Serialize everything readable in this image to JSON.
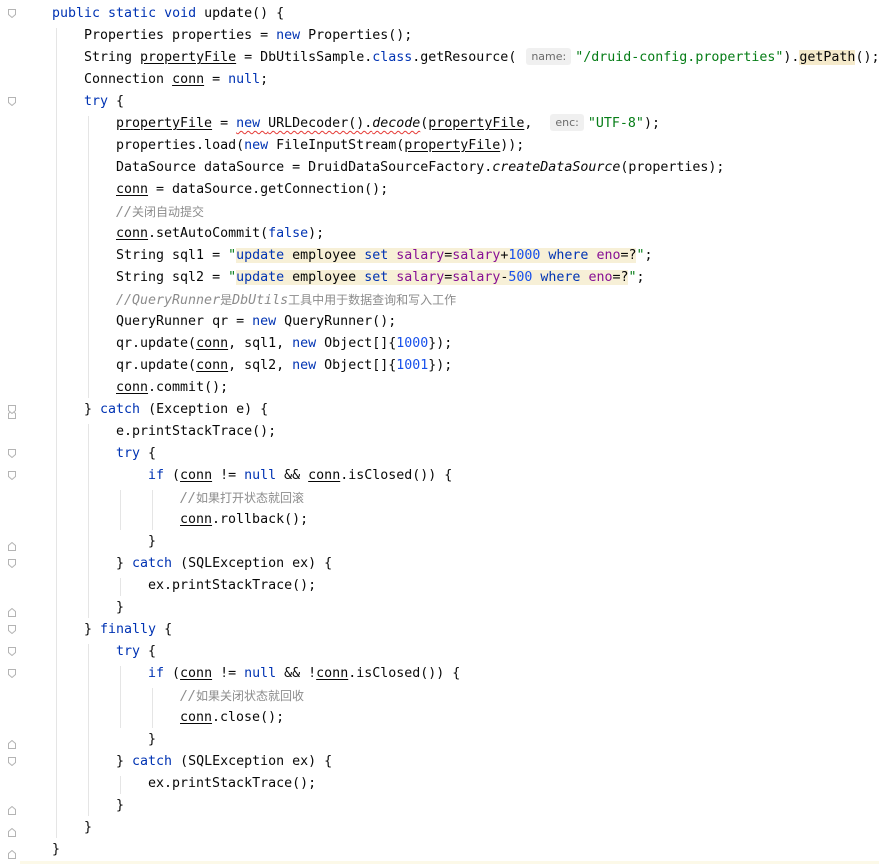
{
  "editor": {
    "lines": [
      {
        "indent": 0,
        "segs": [
          [
            "kw",
            "public static void "
          ],
          [
            "",
            "update() {"
          ]
        ]
      },
      {
        "indent": 1,
        "segs": [
          [
            "",
            "Properties properties = "
          ],
          [
            "kw",
            "new "
          ],
          [
            "",
            "Properties();"
          ]
        ]
      },
      {
        "indent": 1,
        "segs": [
          [
            "",
            "String "
          ],
          [
            "ul",
            "propertyFile"
          ],
          [
            "",
            " = DbUtilsSample."
          ],
          [
            "kw",
            "class"
          ],
          [
            "",
            ".getResource( "
          ],
          [
            "hint",
            "name:"
          ],
          [
            "str",
            "\"/druid-config.properties\""
          ],
          [
            "",
            ")."
          ],
          [
            "hl-y",
            "getPath"
          ],
          [
            "",
            "();"
          ]
        ]
      },
      {
        "indent": 1,
        "segs": [
          [
            "",
            "Connection "
          ],
          [
            "ul",
            "conn"
          ],
          [
            "",
            " = "
          ],
          [
            "kw",
            "null"
          ],
          [
            "",
            ";"
          ]
        ]
      },
      {
        "indent": 1,
        "segs": [
          [
            "kw",
            "try "
          ],
          [
            "",
            "{"
          ]
        ]
      },
      {
        "indent": 2,
        "segs": [
          [
            "ul",
            "propertyFile"
          ],
          [
            "",
            " = "
          ],
          [
            "squig-kw",
            "new "
          ],
          [
            "squig",
            "URLDecoder()."
          ],
          [
            "squig-it",
            "decode"
          ],
          [
            "",
            "("
          ],
          [
            "ul",
            "propertyFile"
          ],
          [
            "",
            ",  "
          ],
          [
            "hint",
            "enc:"
          ],
          [
            "str",
            "\"UTF-8\""
          ],
          [
            "",
            ");"
          ]
        ]
      },
      {
        "indent": 2,
        "segs": [
          [
            "",
            "properties.load("
          ],
          [
            "kw",
            "new "
          ],
          [
            "",
            "FileInputStream("
          ],
          [
            "ul",
            "propertyFile"
          ],
          [
            "",
            "));"
          ]
        ]
      },
      {
        "indent": 2,
        "segs": [
          [
            "",
            "DataSource dataSource = DruidDataSourceFactory."
          ],
          [
            "it",
            "createDataSource"
          ],
          [
            "",
            "(properties);"
          ]
        ]
      },
      {
        "indent": 2,
        "segs": [
          [
            "ul",
            "conn"
          ],
          [
            "",
            " = dataSource.getConnection();"
          ]
        ]
      },
      {
        "indent": 2,
        "segs": [
          [
            "cmt",
            "//"
          ],
          [
            "cmt-cn",
            "关闭自动提交"
          ]
        ]
      },
      {
        "indent": 2,
        "segs": [
          [
            "ul",
            "conn"
          ],
          [
            "",
            ".setAutoCommit("
          ],
          [
            "kw",
            "false"
          ],
          [
            "",
            ");"
          ]
        ]
      },
      {
        "indent": 2,
        "segs": [
          [
            "",
            "String sql1 = "
          ],
          [
            "str",
            "\""
          ],
          [
            "sql-kw",
            "update "
          ],
          [
            "sql",
            "employee "
          ],
          [
            "sql-kw",
            "set "
          ],
          [
            "sql-var",
            "salary"
          ],
          [
            "sql",
            "="
          ],
          [
            "sql-var",
            "salary"
          ],
          [
            "sql",
            "+"
          ],
          [
            "sql-num",
            "1000 "
          ],
          [
            "sql-kw",
            "where "
          ],
          [
            "sql-var",
            "eno"
          ],
          [
            "sql",
            "=?"
          ],
          [
            "str",
            "\""
          ],
          [
            "",
            ";"
          ]
        ]
      },
      {
        "indent": 2,
        "segs": [
          [
            "",
            "String sql2 = "
          ],
          [
            "str",
            "\""
          ],
          [
            "sql-kw",
            "update "
          ],
          [
            "sql",
            "employee "
          ],
          [
            "sql-kw",
            "set "
          ],
          [
            "sql-var",
            "salary"
          ],
          [
            "sql",
            "="
          ],
          [
            "sql-var",
            "salary"
          ],
          [
            "sql",
            "-"
          ],
          [
            "sql-num",
            "500 "
          ],
          [
            "sql-kw",
            "where "
          ],
          [
            "sql-var",
            "eno"
          ],
          [
            "sql",
            "=?"
          ],
          [
            "str",
            "\""
          ],
          [
            "",
            ";"
          ]
        ]
      },
      {
        "indent": 2,
        "segs": [
          [
            "cmt",
            "//QueryRunner"
          ],
          [
            "cmt-cn",
            "是"
          ],
          [
            "cmt",
            "DbUtils"
          ],
          [
            "cmt-cn",
            "工具中用于数据查询和写入工作"
          ]
        ]
      },
      {
        "indent": 2,
        "segs": [
          [
            "",
            "QueryRunner qr = "
          ],
          [
            "kw",
            "new "
          ],
          [
            "",
            "QueryRunner();"
          ]
        ]
      },
      {
        "indent": 2,
        "segs": [
          [
            "",
            "qr.update("
          ],
          [
            "ul",
            "conn"
          ],
          [
            "",
            ", sql1, "
          ],
          [
            "kw",
            "new "
          ],
          [
            "",
            "Object[]{"
          ],
          [
            "num",
            "1000"
          ],
          [
            "",
            "});"
          ]
        ]
      },
      {
        "indent": 2,
        "segs": [
          [
            "",
            "qr.update("
          ],
          [
            "ul",
            "conn"
          ],
          [
            "",
            ", sql2, "
          ],
          [
            "kw",
            "new "
          ],
          [
            "",
            "Object[]{"
          ],
          [
            "num",
            "1001"
          ],
          [
            "",
            "});"
          ]
        ]
      },
      {
        "indent": 2,
        "segs": [
          [
            "ul",
            "conn"
          ],
          [
            "",
            ".commit();"
          ]
        ]
      },
      {
        "indent": 1,
        "segs": [
          [
            "",
            "} "
          ],
          [
            "kw",
            "catch "
          ],
          [
            "",
            "(Exception e) {"
          ]
        ]
      },
      {
        "indent": 2,
        "segs": [
          [
            "",
            "e.printStackTrace();"
          ]
        ]
      },
      {
        "indent": 2,
        "segs": [
          [
            "kw",
            "try "
          ],
          [
            "",
            "{"
          ]
        ]
      },
      {
        "indent": 3,
        "segs": [
          [
            "kw",
            "if "
          ],
          [
            "",
            "("
          ],
          [
            "ul",
            "conn"
          ],
          [
            "",
            " != "
          ],
          [
            "kw",
            "null "
          ],
          [
            "",
            "&& "
          ],
          [
            "ul",
            "conn"
          ],
          [
            "",
            ".isClosed()) {"
          ]
        ]
      },
      {
        "indent": 4,
        "segs": [
          [
            "cmt",
            "//"
          ],
          [
            "cmt-cn",
            "如果打开状态就回滚"
          ]
        ]
      },
      {
        "indent": 4,
        "segs": [
          [
            "ul",
            "conn"
          ],
          [
            "",
            ".rollback();"
          ]
        ]
      },
      {
        "indent": 3,
        "segs": [
          [
            "",
            "}"
          ]
        ]
      },
      {
        "indent": 2,
        "segs": [
          [
            "",
            "} "
          ],
          [
            "kw",
            "catch "
          ],
          [
            "",
            "(SQLException ex) {"
          ]
        ]
      },
      {
        "indent": 3,
        "segs": [
          [
            "",
            "ex.printStackTrace();"
          ]
        ]
      },
      {
        "indent": 2,
        "segs": [
          [
            "",
            "}"
          ]
        ]
      },
      {
        "indent": 1,
        "segs": [
          [
            "",
            "} "
          ],
          [
            "kw",
            "finally "
          ],
          [
            "",
            "{"
          ]
        ]
      },
      {
        "indent": 2,
        "segs": [
          [
            "kw",
            "try "
          ],
          [
            "",
            "{"
          ]
        ]
      },
      {
        "indent": 3,
        "segs": [
          [
            "kw",
            "if "
          ],
          [
            "",
            "("
          ],
          [
            "ul",
            "conn"
          ],
          [
            "",
            " != "
          ],
          [
            "kw",
            "null "
          ],
          [
            "",
            "&& !"
          ],
          [
            "ul",
            "conn"
          ],
          [
            "",
            ".isClosed()) {"
          ]
        ]
      },
      {
        "indent": 4,
        "segs": [
          [
            "cmt",
            "//"
          ],
          [
            "cmt-cn",
            "如果关闭状态就回收"
          ]
        ]
      },
      {
        "indent": 4,
        "segs": [
          [
            "ul",
            "conn"
          ],
          [
            "",
            ".close();"
          ]
        ]
      },
      {
        "indent": 3,
        "segs": [
          [
            "",
            "}"
          ]
        ]
      },
      {
        "indent": 2,
        "segs": [
          [
            "",
            "} "
          ],
          [
            "kw",
            "catch "
          ],
          [
            "",
            "(SQLException ex) {"
          ]
        ]
      },
      {
        "indent": 3,
        "segs": [
          [
            "",
            "ex.printStackTrace();"
          ]
        ]
      },
      {
        "indent": 2,
        "segs": [
          [
            "",
            "}"
          ]
        ]
      },
      {
        "indent": 1,
        "segs": [
          [
            "",
            "}"
          ]
        ]
      },
      {
        "indent": 0,
        "segs": [
          [
            "",
            "}"
          ]
        ]
      }
    ],
    "fold_markers": [
      {
        "line": 0,
        "dir": "open"
      },
      {
        "line": 4,
        "dir": "open"
      },
      {
        "line": 18,
        "dir": "close"
      },
      {
        "line": 18,
        "dir": "open"
      },
      {
        "line": 20,
        "dir": "open"
      },
      {
        "line": 21,
        "dir": "open"
      },
      {
        "line": 24,
        "dir": "close"
      },
      {
        "line": 25,
        "dir": "open"
      },
      {
        "line": 27,
        "dir": "close"
      },
      {
        "line": 28,
        "dir": "open"
      },
      {
        "line": 29,
        "dir": "open"
      },
      {
        "line": 30,
        "dir": "open"
      },
      {
        "line": 33,
        "dir": "close"
      },
      {
        "line": 34,
        "dir": "open"
      },
      {
        "line": 36,
        "dir": "close"
      },
      {
        "line": 37,
        "dir": "close"
      },
      {
        "line": 38,
        "dir": "close"
      }
    ]
  },
  "colors": {
    "keyword": "#0033b3",
    "string": "#067d17",
    "number": "#1750eb",
    "sql_variable": "#871094",
    "comment": "#8c8c8c",
    "highlight": "#f5eacb",
    "error_squiggle": "#e53935"
  }
}
